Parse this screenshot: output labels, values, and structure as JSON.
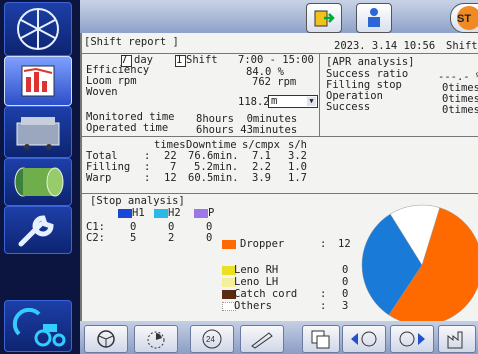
{
  "header": {
    "title": "[Shift report ]",
    "datetime": "2023. 3.14 10:56",
    "shift_label": "Shift"
  },
  "period": {
    "option1_num": "7",
    "option1_label": "day",
    "option2_num": "1",
    "option2_label": "Shift",
    "time_range": "7:00 - 15:00"
  },
  "stats": {
    "efficiency_label": "Efficiency",
    "efficiency_value": "84.0 %",
    "loom_rpm_label": "Loom rpm",
    "loom_rpm_value": "762 rpm",
    "woven_label": "Woven",
    "woven_value": "118.2",
    "woven_unit": "m",
    "monitored_label": "Monitored time",
    "monitored_value": "8hours  0minutes",
    "operated_label": "Operated time",
    "operated_value": "6hours 43minutes"
  },
  "apr": {
    "title": "[APR analysis]",
    "rows": [
      {
        "label": "Success ratio",
        "value": "---.- %"
      },
      {
        "label": "Filling stop",
        "value": "0times"
      },
      {
        "label": "Operation",
        "value": "0times"
      },
      {
        "label": "Success",
        "value": "0times"
      }
    ]
  },
  "stop_table": {
    "headers": [
      "times",
      "Downtime",
      "s/cmpx",
      "s/h"
    ],
    "rows": [
      {
        "label": "Total",
        "times": "22",
        "downtime": "76.6min.",
        "scmpx": "7.1",
        "sh": "3.2"
      },
      {
        "label": "Filling",
        "times": "7",
        "downtime": "5.2min.",
        "scmpx": "2.2",
        "sh": "1.0"
      },
      {
        "label": "Warp",
        "times": "12",
        "downtime": "60.5min.",
        "scmpx": "3.9",
        "sh": "1.7"
      }
    ]
  },
  "stop_analysis": {
    "title": "[Stop analysis]",
    "legend": [
      {
        "label": "H1",
        "color": "#1a47d8"
      },
      {
        "label": "H2",
        "color": "#29b8e8"
      },
      {
        "label": "P",
        "color": "#9a78e8"
      }
    ],
    "rows": [
      {
        "label": "C1:",
        "h1": "0",
        "h2": "0",
        "p": "0"
      },
      {
        "label": "C2:",
        "h1": "5",
        "h2": "2",
        "p": "0"
      }
    ],
    "causes": [
      {
        "label": "Dropper",
        "value": "12",
        "color": "#ff6a00"
      },
      {
        "label": "Leno RH",
        "value": "0",
        "color": "#e8e020"
      },
      {
        "label": "Leno LH",
        "value": "0",
        "color": "#f4ef9a"
      },
      {
        "label": "Catch cord",
        "value": "0",
        "color": "#5a2a12"
      },
      {
        "label": "Others",
        "value": "3",
        "color": "#ffffff"
      }
    ],
    "pie": [
      {
        "label": "Dropper",
        "value": 12,
        "color": "#ff6a00"
      },
      {
        "label": "C2",
        "value": 7,
        "color": "#1a7ad8"
      },
      {
        "label": "Others",
        "value": 3,
        "color": "#ffffff"
      }
    ]
  },
  "sidebar": {
    "items": [
      "fan-icon",
      "chart-report-icon",
      "loom-icon",
      "fabric-roll-icon",
      "wrench-icon",
      "tractor-icon"
    ]
  },
  "topbar": {
    "st_label": "ST"
  },
  "bottombar": {
    "labels": {
      "page_24": "24"
    }
  }
}
